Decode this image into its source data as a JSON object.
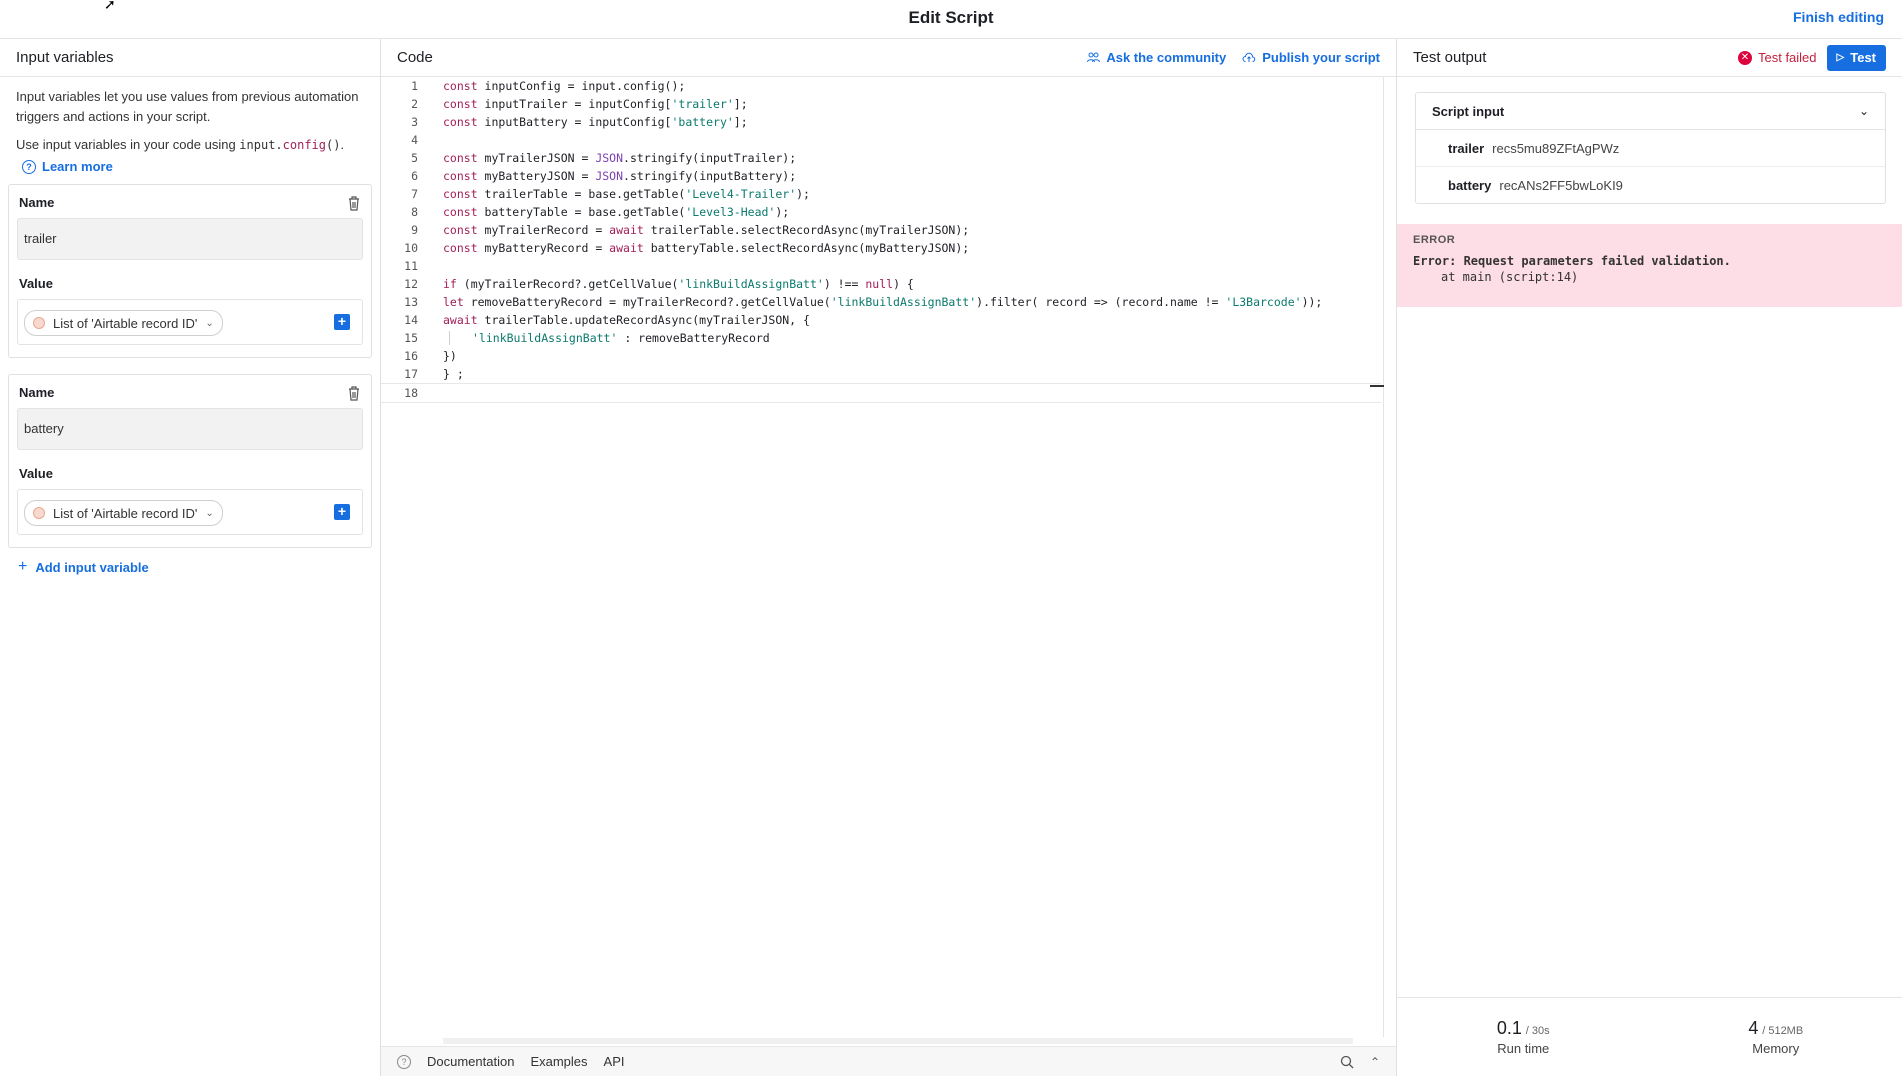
{
  "window": {
    "title": "Edit Script",
    "finish_label": "Finish editing"
  },
  "left": {
    "header": "Input variables",
    "intro1": "Input variables let you use values from previous automation triggers and actions in your script.",
    "intro2_prefix": "Use input variables in your code using ",
    "intro2_code_a": "input.",
    "intro2_code_b": "config",
    "intro2_code_c": "()",
    "intro2_suffix": ".",
    "learn_more": "Learn more",
    "variables": [
      {
        "name_label": "Name",
        "name_value": "trailer",
        "value_label": "Value",
        "value_pill": "List of 'Airtable record ID'"
      },
      {
        "name_label": "Name",
        "name_value": "battery",
        "value_label": "Value",
        "value_pill": "List of 'Airtable record ID'"
      }
    ],
    "add_variable": "Add input variable"
  },
  "code": {
    "header": "Code",
    "ask_community": "Ask the community",
    "publish": "Publish your script",
    "footer": {
      "documentation": "Documentation",
      "examples": "Examples",
      "api": "API"
    },
    "line_numbers": [
      "1",
      "2",
      "3",
      "4",
      "5",
      "6",
      "7",
      "8",
      "9",
      "10",
      "11",
      "12",
      "13",
      "14",
      "15",
      "16",
      "17",
      "18"
    ],
    "lines": [
      [
        {
          "t": "const ",
          "c": "kw"
        },
        {
          "t": "inputConfig = input.config();",
          "c": ""
        }
      ],
      [
        {
          "t": "const ",
          "c": "kw"
        },
        {
          "t": "inputTrailer = inputConfig[",
          "c": ""
        },
        {
          "t": "'trailer'",
          "c": "str"
        },
        {
          "t": "];",
          "c": ""
        }
      ],
      [
        {
          "t": "const ",
          "c": "kw"
        },
        {
          "t": "inputBattery = inputConfig[",
          "c": ""
        },
        {
          "t": "'battery'",
          "c": "str"
        },
        {
          "t": "];",
          "c": ""
        }
      ],
      [],
      [
        {
          "t": "const ",
          "c": "kw"
        },
        {
          "t": "myTrailerJSON = ",
          "c": ""
        },
        {
          "t": "JSON",
          "c": "glob"
        },
        {
          "t": ".stringify(inputTrailer);",
          "c": ""
        }
      ],
      [
        {
          "t": "const ",
          "c": "kw"
        },
        {
          "t": "myBatteryJSON = ",
          "c": ""
        },
        {
          "t": "JSON",
          "c": "glob"
        },
        {
          "t": ".stringify(inputBattery);",
          "c": ""
        }
      ],
      [
        {
          "t": "const ",
          "c": "kw"
        },
        {
          "t": "trailerTable = base.getTable(",
          "c": ""
        },
        {
          "t": "'Level4-Trailer'",
          "c": "str"
        },
        {
          "t": ");",
          "c": ""
        }
      ],
      [
        {
          "t": "const ",
          "c": "kw"
        },
        {
          "t": "batteryTable = base.getTable(",
          "c": ""
        },
        {
          "t": "'Level3-Head'",
          "c": "str"
        },
        {
          "t": ");",
          "c": ""
        }
      ],
      [
        {
          "t": "const ",
          "c": "kw"
        },
        {
          "t": "myTrailerRecord = ",
          "c": ""
        },
        {
          "t": "await ",
          "c": "kw"
        },
        {
          "t": "trailerTable.selectRecordAsync(myTrailerJSON);",
          "c": ""
        }
      ],
      [
        {
          "t": "const ",
          "c": "kw"
        },
        {
          "t": "myBatteryRecord = ",
          "c": ""
        },
        {
          "t": "await ",
          "c": "kw"
        },
        {
          "t": "batteryTable.selectRecordAsync(myBatteryJSON);",
          "c": ""
        }
      ],
      [],
      [
        {
          "t": "if ",
          "c": "kw"
        },
        {
          "t": "(myTrailerRecord?.getCellValue(",
          "c": ""
        },
        {
          "t": "'linkBuildAssignBatt'",
          "c": "str"
        },
        {
          "t": ") !== ",
          "c": ""
        },
        {
          "t": "null",
          "c": "kw"
        },
        {
          "t": ") {",
          "c": ""
        }
      ],
      [
        {
          "t": "let ",
          "c": "kw"
        },
        {
          "t": "removeBatteryRecord = myTrailerRecord?.getCellValue(",
          "c": ""
        },
        {
          "t": "'linkBuildAssignBatt'",
          "c": "str"
        },
        {
          "t": ").filter( record => (record.name != ",
          "c": ""
        },
        {
          "t": "'L3Barcode'",
          "c": "str"
        },
        {
          "t": "));",
          "c": ""
        }
      ],
      [
        {
          "t": "await ",
          "c": "kw"
        },
        {
          "t": "trailerTable.updateRecordAsync(myTrailerJSON, {",
          "c": ""
        }
      ],
      [
        {
          "t": "'linkBuildAssignBatt'",
          "c": "str",
          "indent": true
        },
        {
          "t": " : removeBatteryRecord",
          "c": ""
        }
      ],
      [
        {
          "t": "})",
          "c": ""
        }
      ],
      [
        {
          "t": "} ;",
          "c": ""
        }
      ],
      []
    ]
  },
  "right": {
    "header": "Test output",
    "status": "Test failed",
    "test_label": "Test",
    "script_input": "Script input",
    "inputs": [
      {
        "key": "trailer",
        "value": "recs5mu89ZFtAgPWz"
      },
      {
        "key": "battery",
        "value": "recANs2FF5bwLoKI9"
      }
    ],
    "error_title": "ERROR",
    "error_message": "Error: Request parameters failed validation.",
    "error_where": "at main (script:14)",
    "runtime_value": "0.1",
    "runtime_limit": "/ 30s",
    "runtime_label": "Run time",
    "memory_value": "4",
    "memory_limit": "/ 512MB",
    "memory_label": "Memory"
  },
  "colors": {
    "accent": "#166ee1",
    "error": "#dc043b",
    "error_bg": "#fddde6",
    "keyword": "#a31f58",
    "string": "#0b7a6d"
  }
}
